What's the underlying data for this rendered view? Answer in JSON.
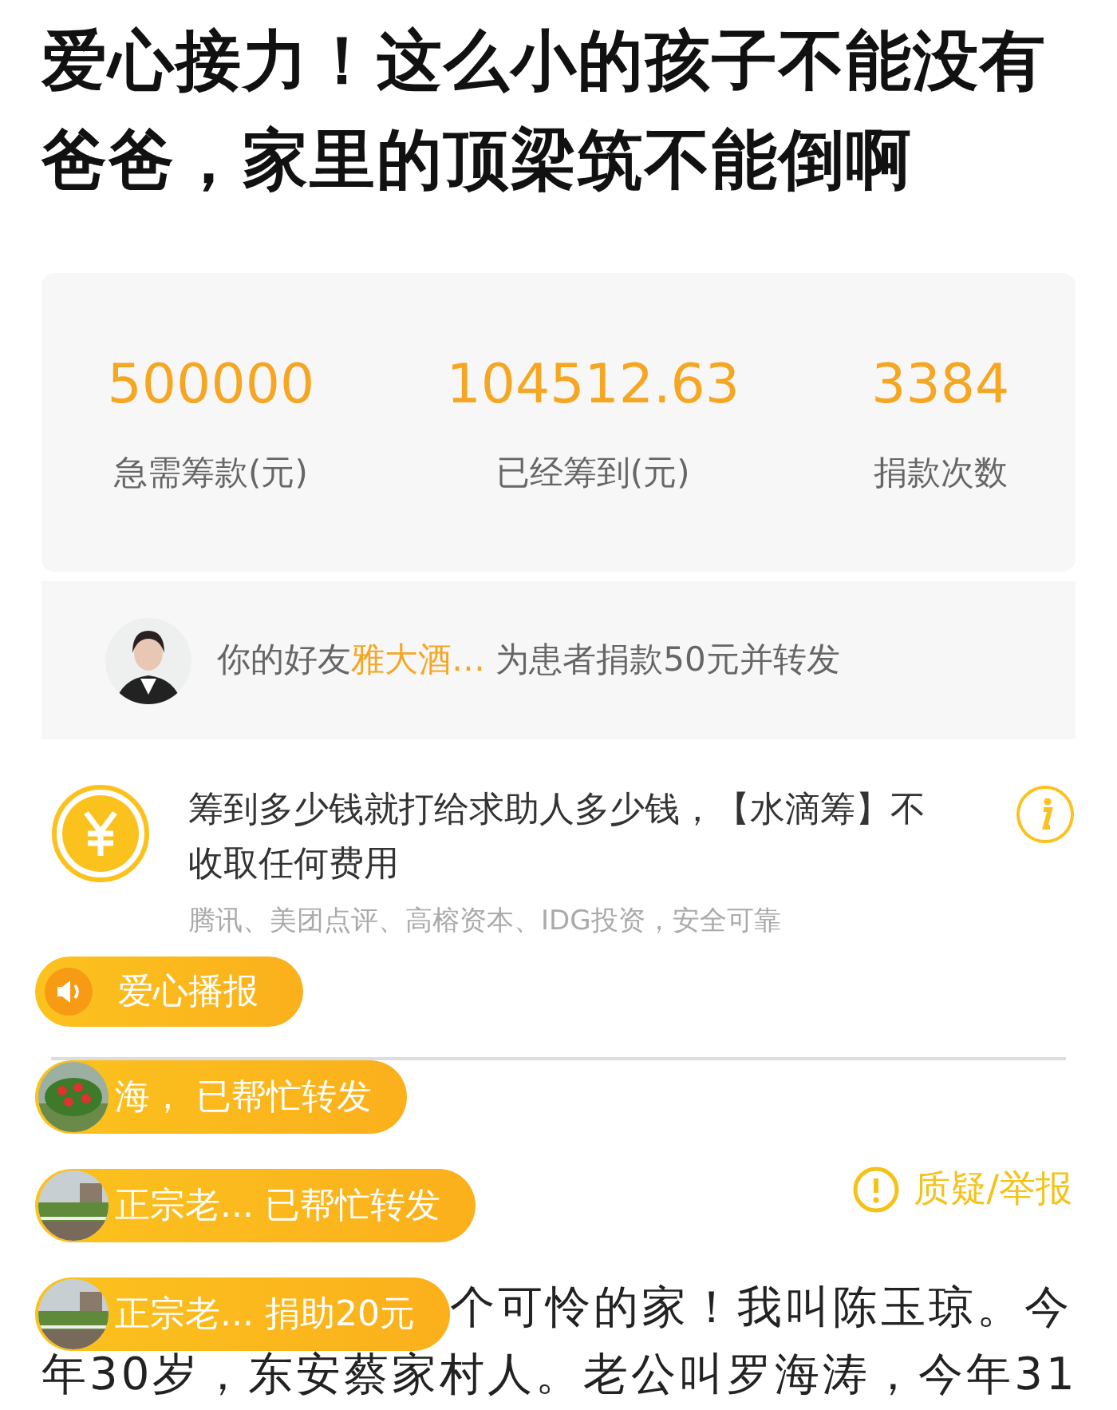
{
  "title": "爱心接力！这么小的孩子不能没有爸爸，家里的顶梁筑不能倒啊",
  "stats": [
    {
      "value": "500000",
      "label": "急需筹款(元)"
    },
    {
      "value": "104512.63",
      "label": "已经筹到(元)"
    },
    {
      "value": "3384",
      "label": "捐款次数"
    }
  ],
  "friend_donation": {
    "prefix": "你的好友",
    "name": "雅大酒…",
    "action": "为患者捐款50元并转发"
  },
  "guarantee": {
    "text": "筹到多少钱就打给求助人多少钱，【水滴筹】不收取任何费用",
    "backers": "腾讯、美团点评、高榕资本、IDG投资，安全可靠"
  },
  "broadcast": {
    "label": "爱心播报",
    "items": [
      {
        "text": "海， 已帮忙转发"
      },
      {
        "text": "正宗老... 已帮忙转发"
      },
      {
        "text": "正宗老... 捐助20元"
      }
    ]
  },
  "report_link": "质疑/举报",
  "story_lines": [
    "个可怜的家！我叫陈玉琼。今",
    "年30岁，东安蔡家村人。老公叫罗海涛，今年31"
  ]
}
